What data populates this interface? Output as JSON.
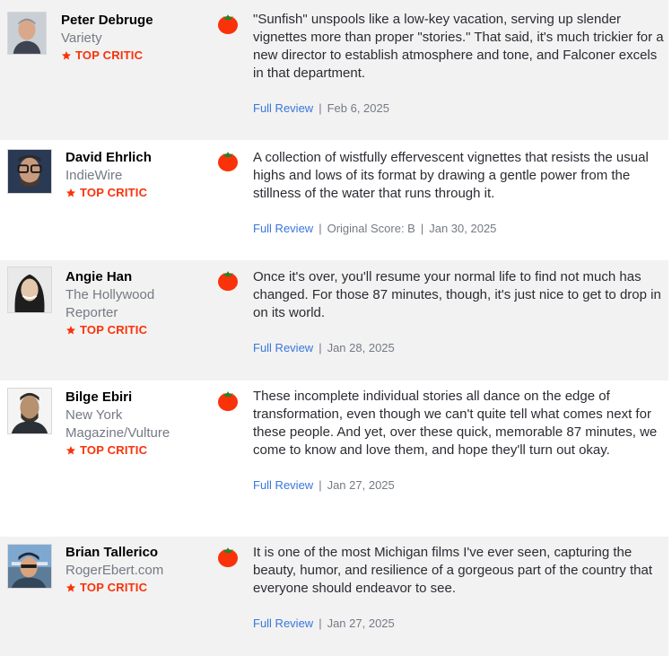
{
  "colors": {
    "top_critic": "#fa320a",
    "link": "#3976dc",
    "row_alt_bg": "#f2f2f2",
    "muted_text": "#757a84"
  },
  "icons": {
    "fresh": "fresh-tomato-icon",
    "star": "star-icon"
  },
  "separator": "|",
  "reviews": [
    {
      "critic": "Peter Debruge",
      "publication": "Variety",
      "badge": "TOP CRITIC",
      "quote": "\"Sunfish\" unspools like a low-key vacation, serving up slender vignettes more than proper \"stories.\" That said, it's much trickier for a new director to establish atmosphere and tone, and Falconer excels in that department.",
      "link_label": "Full Review",
      "score": "",
      "date": "Feb 6, 2025"
    },
    {
      "critic": "David Ehrlich",
      "publication": "IndieWire",
      "badge": "TOP CRITIC",
      "quote": "A collection of wistfully effervescent vignettes that resists the usual highs and lows of its format by drawing a gentle power from the stillness of the water that runs through it.",
      "link_label": "Full Review",
      "score": "Original Score: B",
      "date": "Jan 30, 2025"
    },
    {
      "critic": "Angie Han",
      "publication": "The Hollywood Reporter",
      "badge": "TOP CRITIC",
      "quote": "Once it's over, you'll resume your normal life to find not much has changed. For those 87 minutes, though, it's just nice to get to drop in on its world.",
      "link_label": "Full Review",
      "score": "",
      "date": "Jan 28, 2025"
    },
    {
      "critic": "Bilge Ebiri",
      "publication": "New York Magazine/Vulture",
      "badge": "TOP CRITIC",
      "quote": "These incomplete individual stories all dance on the edge of transformation, even though we can't quite tell what comes next for these people. And yet, over these quick, memorable 87 minutes, we come to know and love them, and hope they'll turn out okay.",
      "link_label": "Full Review",
      "score": "",
      "date": "Jan 27, 2025"
    },
    {
      "critic": "Brian Tallerico",
      "publication": "RogerEbert.com",
      "badge": "TOP CRITIC",
      "quote": "It is one of the most Michigan films I've ever seen, capturing the beauty, humor, and resilience of a gorgeous part of the country that everyone should endeavor to see.",
      "link_label": "Full Review",
      "score": "",
      "date": "Jan 27, 2025"
    }
  ]
}
